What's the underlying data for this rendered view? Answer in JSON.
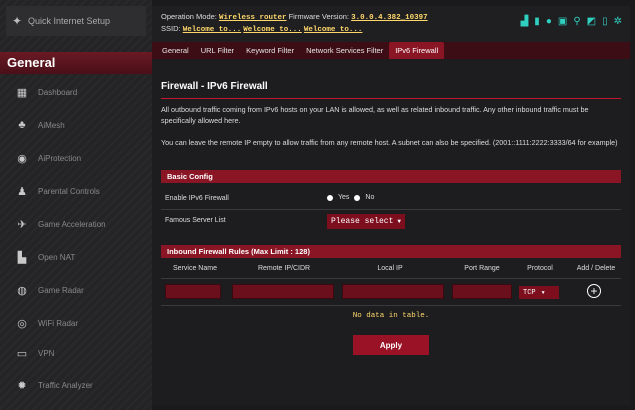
{
  "sidebar": {
    "quick_setup": "Quick Internet Setup",
    "section_title": "General",
    "items": [
      {
        "label": "Dashboard",
        "icon": "dashboard-icon"
      },
      {
        "label": "AiMesh",
        "icon": "aimesh-icon"
      },
      {
        "label": "AiProtection",
        "icon": "aiprotection-icon"
      },
      {
        "label": "Parental Controls",
        "icon": "parental-controls-icon"
      },
      {
        "label": "Game Acceleration",
        "icon": "game-acceleration-icon"
      },
      {
        "label": "Open NAT",
        "icon": "open-nat-icon"
      },
      {
        "label": "Game Radar",
        "icon": "game-radar-icon"
      },
      {
        "label": "WiFi Radar",
        "icon": "wifi-radar-icon"
      },
      {
        "label": "VPN",
        "icon": "vpn-icon"
      },
      {
        "label": "Traffic Analyzer",
        "icon": "traffic-analyzer-icon"
      }
    ]
  },
  "topbar": {
    "opmode_label": "Operation Mode:",
    "opmode_value": "Wireless router",
    "fw_label": "Firmware Version:",
    "fw_value": "3.0.0.4.382_10397",
    "ssid_label": "SSID:",
    "ssid_1": "Welcome to...",
    "ssid_2": "Welcome to...",
    "ssid_3": "Welcome to..."
  },
  "tabs": [
    {
      "label": "General",
      "active": false
    },
    {
      "label": "URL Filter",
      "active": false
    },
    {
      "label": "Keyword Filter",
      "active": false
    },
    {
      "label": "Network Services Filter",
      "active": false
    },
    {
      "label": "IPv6 Firewall",
      "active": true
    }
  ],
  "page": {
    "title": "Firewall - IPv6 Firewall",
    "desc1": "All outbound traffic coming from IPv6 hosts on your LAN is allowed, as well as related inbound traffic. Any other inbound traffic must be specifically allowed here.",
    "desc2": "You can leave the remote IP empty to allow traffic from any remote host. A subnet can also be specified. (2001::1111:2222:3333/64 for example)",
    "basic_config_title": "Basic Config",
    "enable_label": "Enable IPv6 Firewall",
    "yes_label": "Yes",
    "no_label": "No",
    "famous_label": "Famous Server List",
    "famous_value": "Please select",
    "rules_title": "Inbound Firewall Rules (Max Limit : 128)",
    "columns": [
      "Service Name",
      "Remote IP/CIDR",
      "Local IP",
      "Port Range",
      "Protocol",
      "Add / Delete"
    ],
    "protocol_value": "TCP",
    "empty_msg": "No data in table.",
    "apply_label": "Apply"
  },
  "colors": {
    "accent": "#8a1525",
    "highlight": "#ffd86b",
    "background": "#1d1d1f"
  }
}
